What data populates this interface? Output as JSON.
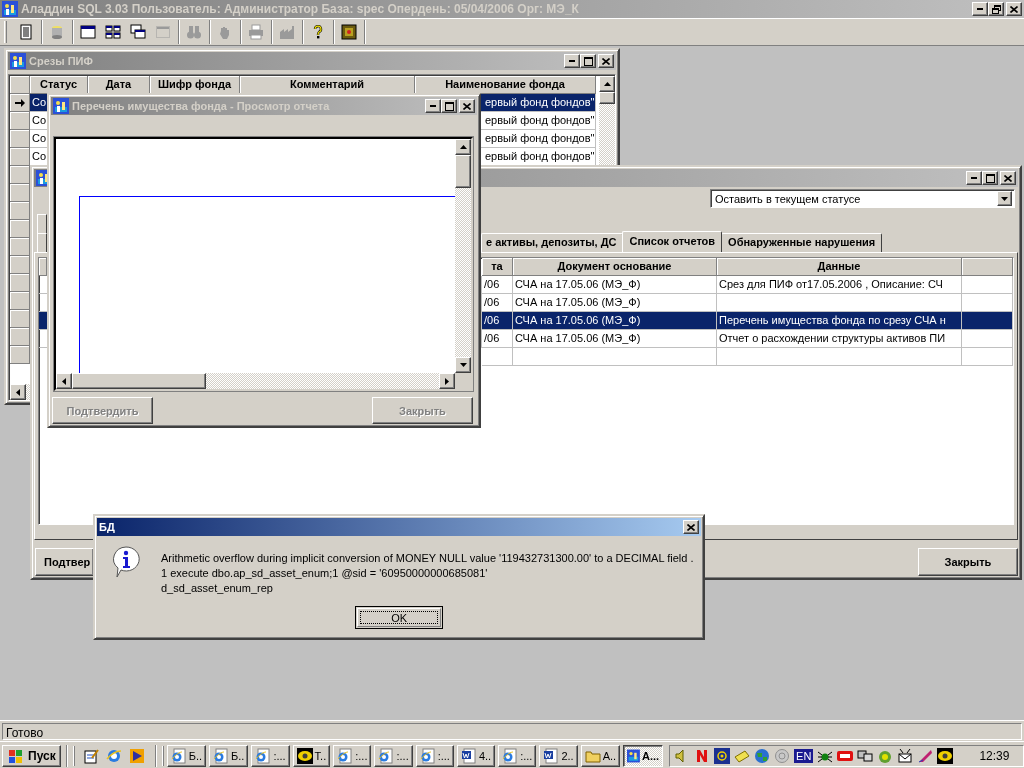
{
  "app": {
    "title": "Аладдин SQL 3.03 Пользователь: Администратор База: spec Опердень: 05/04/2006 Орг: МЭ_К"
  },
  "toolbar": [
    {
      "disabled": false
    },
    {
      "disabled": false
    },
    {
      "disabled": false
    },
    {
      "disabled": false
    },
    {
      "disabled": false
    },
    {
      "disabled": true
    },
    {
      "disabled": true
    },
    {
      "disabled": true
    },
    {
      "disabled": true
    },
    {
      "disabled": true
    },
    {
      "disabled": false
    },
    {
      "disabled": false
    }
  ],
  "slices_window": {
    "title": "Срезы ПИФ",
    "columns": [
      "Статус",
      "Дата",
      "Шифр фонда",
      "Комментарий",
      "Наименование фонда"
    ],
    "rows": [
      {
        "status": "Со",
        "fund_name": "ервый фонд фондов\"",
        "selected": true
      },
      {
        "status": "Со",
        "fund_name": "ервый фонд фондов\"",
        "selected": false
      },
      {
        "status": "Со",
        "fund_name": "ервый фонд фондов\"",
        "selected": false
      },
      {
        "status": "Со",
        "fund_name": "ервый фонд фондов\"",
        "selected": false
      }
    ]
  },
  "fund_window": {
    "status_action": "Оставить в текущем статусе",
    "tabs": [
      {
        "label": "е активы, депозиты, ДС",
        "selected": false
      },
      {
        "label": "Список отчетов",
        "selected": true
      },
      {
        "label": "Обнаруженные нарушения",
        "selected": false
      }
    ],
    "columns": [
      "та",
      "Документ основание",
      "Данные"
    ],
    "rows": [
      {
        "date": "/06",
        "document": "СЧА на 17.05.06 (МЭ_Ф)",
        "data": "Срез для ПИФ от17.05.2006 , Описание: СЧ",
        "selected": false
      },
      {
        "date": "/06",
        "document": "СЧА на 17.05.06 (МЭ_Ф)",
        "selected": false
      },
      {
        "date": "/06",
        "document": "СЧА на 17.05.06 (МЭ_Ф)",
        "data": "Перечень имущества фонда по срезу СЧА н",
        "selected": true
      },
      {
        "date": "/06",
        "document": "СЧА на 17.05.06 (МЭ_Ф)",
        "data": "Отчет о расхождении структуры активов ПИ",
        "selected": false
      }
    ],
    "buttons": [
      "Подтвер",
      "Закрыть"
    ]
  },
  "report_window": {
    "title": "Перечень имущества фонда - Просмотр отчета",
    "buttons": [
      {
        "label": "Подтвердить",
        "disabled": true
      },
      {
        "label": "Закрыть",
        "disabled": true
      }
    ]
  },
  "error_dialog": {
    "title": "БД",
    "message_lines": [
      "Arithmetic overflow during implicit conversion of MONEY NULL value '119432731300.00' to a DECIMAL field .",
      "1 execute dbo.ap_sd_asset_enum;1 @sid = '60950000000685081'",
      "d_sd_asset_enum_rep"
    ],
    "button": "OK"
  },
  "status_bar": {
    "text": "Готово"
  },
  "taskbar": {
    "start": "Пуск",
    "tasks": [
      {
        "label": "Б..",
        "kind": "ie",
        "selected": false
      },
      {
        "label": "Б..",
        "kind": "ie",
        "selected": false
      },
      {
        "label": ":...",
        "kind": "ie",
        "selected": false
      },
      {
        "label": "Т..",
        "kind": "eye",
        "selected": false
      },
      {
        "label": ":...",
        "kind": "ie",
        "selected": false
      },
      {
        "label": ":...",
        "kind": "ie",
        "selected": false
      },
      {
        "label": ":...",
        "kind": "ie",
        "selected": false
      },
      {
        "label": "4..",
        "kind": "word",
        "selected": false
      },
      {
        "label": ":...",
        "kind": "ie",
        "selected": false
      },
      {
        "label": "2..",
        "kind": "word",
        "selected": false
      },
      {
        "label": "А..",
        "kind": "folder",
        "selected": false
      },
      {
        "label": "А...",
        "kind": "app",
        "selected": true
      }
    ],
    "language": "EN",
    "clock": "12:39"
  }
}
